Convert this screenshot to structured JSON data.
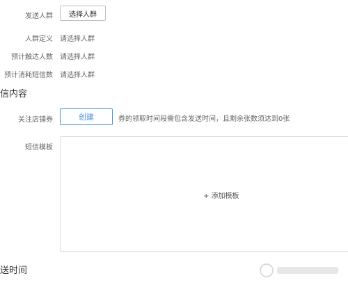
{
  "audience": {
    "send_label": "发送人群",
    "select_button": "选择人群",
    "definition_label": "人群定义",
    "definition_value": "请选择人群",
    "reach_label": "预计触达人数",
    "reach_value": "请选择人群",
    "sms_cost_label": "预计消耗短信数",
    "sms_cost_value": "请选择人群"
  },
  "content_section": {
    "title": "信内容",
    "coupon_label": "关注店铺券",
    "create_button": "创建",
    "coupon_tip": "券的领取时间段需包含发送时间，且剩余张数须达到0张",
    "template_label": "短信模板",
    "add_template": "+ 添加模板"
  },
  "time_section": {
    "title": "送时间"
  },
  "colors": {
    "accent": "#4a90d9",
    "label": "#666666",
    "border": "#dcdcdc"
  }
}
